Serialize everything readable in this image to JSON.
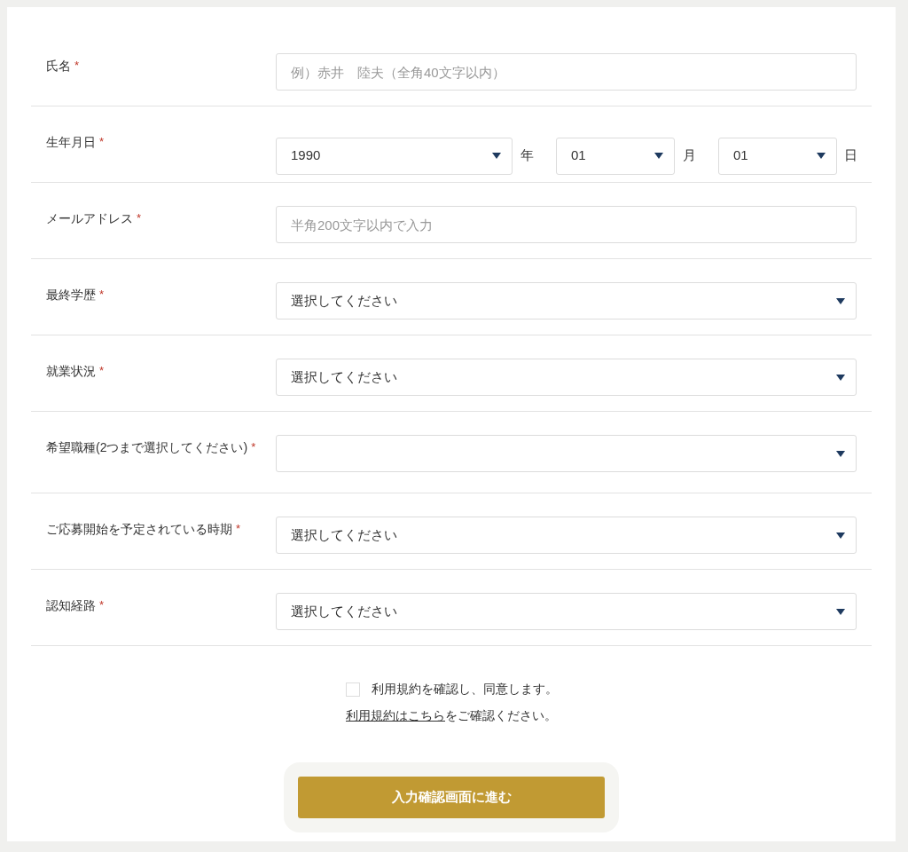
{
  "fields": [
    {
      "kind": "text",
      "label": "氏名",
      "required": "*",
      "placeholder": "例）赤井　陸夫（全角40文字以内）"
    },
    {
      "kind": "date",
      "label": "生年月日",
      "required": "*",
      "parts": [
        {
          "value": "1990",
          "unit": "年"
        },
        {
          "value": "01",
          "unit": "月"
        },
        {
          "value": "01",
          "unit": "日"
        }
      ]
    },
    {
      "kind": "text",
      "label": "メールアドレス",
      "required": "*",
      "placeholder": "半角200文字以内で入力"
    },
    {
      "kind": "select",
      "label": "最終学歴",
      "required": "*",
      "value": "選択してください"
    },
    {
      "kind": "select",
      "label": "就業状況",
      "required": "*",
      "value": "選択してください"
    },
    {
      "kind": "multiselect",
      "label": "希望職種(2つまで選択してください)",
      "required": "*"
    },
    {
      "kind": "select",
      "label": "ご応募開始を予定されている時期",
      "required": "*",
      "value": "選択してください"
    },
    {
      "kind": "select",
      "label": "認知経路",
      "required": "*",
      "value": "選択してください"
    }
  ],
  "agreement": {
    "label": "利用規約を確認し、同意します。",
    "checked": false
  },
  "terms_note": {
    "link": "利用規約はこちら",
    "text": "をご確認ください。"
  },
  "submit_button": "入力確認画面に進む"
}
